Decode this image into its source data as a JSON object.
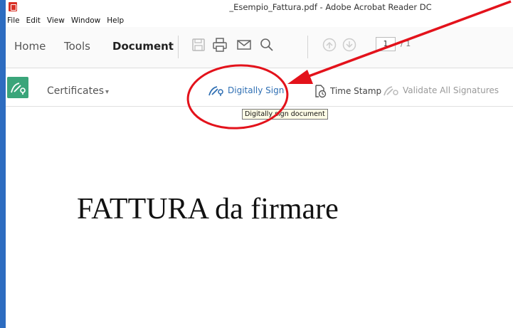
{
  "window": {
    "title": "_Esempio_Fattura.pdf - Adobe Acrobat Reader DC"
  },
  "menu": [
    "File",
    "Edit",
    "View",
    "Window",
    "Help"
  ],
  "toolbar": {
    "tabs": [
      {
        "label": "Home"
      },
      {
        "label": "Tools"
      },
      {
        "label": "Document"
      }
    ],
    "page_current": "1",
    "page_total": "/ 1"
  },
  "certificates": {
    "label": "Certificates",
    "caret": "▾",
    "digitally_sign": "Digitally Sign",
    "time_stamp": "Time Stamp",
    "validate_all": "Validate All Signatures"
  },
  "tooltip": "Digitally sign document",
  "document": {
    "title": "FATTURA da firmare"
  },
  "colors": {
    "accent": "#2f6fb3",
    "cert_tile": "#3aa57a",
    "window_border": "#2d6cc0",
    "annotation": "#e3121b"
  }
}
